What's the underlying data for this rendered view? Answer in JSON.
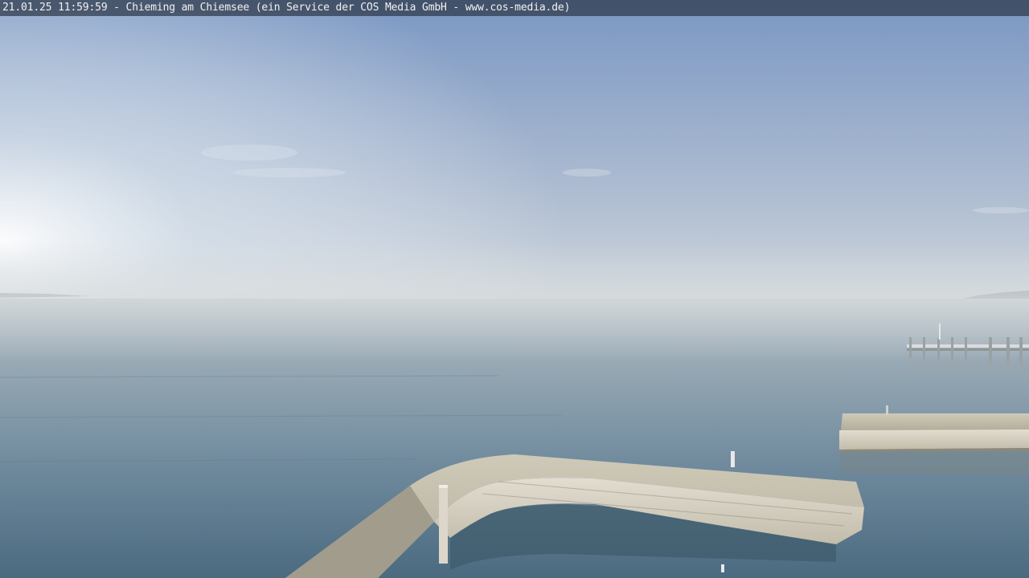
{
  "overlay": {
    "caption": "21.01.25 11:59:59 - Chieming am Chiemsee (ein Service der COS Media GmbH - www.cos-media.de)"
  },
  "colors": {
    "sky_top": "#7d9ac4",
    "sky_horizon": "#c9d3dc",
    "water_far": "#aab6c0",
    "water_near": "#4f6f86",
    "concrete": "#c9c3b2",
    "concrete_shadow": "#8c887c"
  }
}
